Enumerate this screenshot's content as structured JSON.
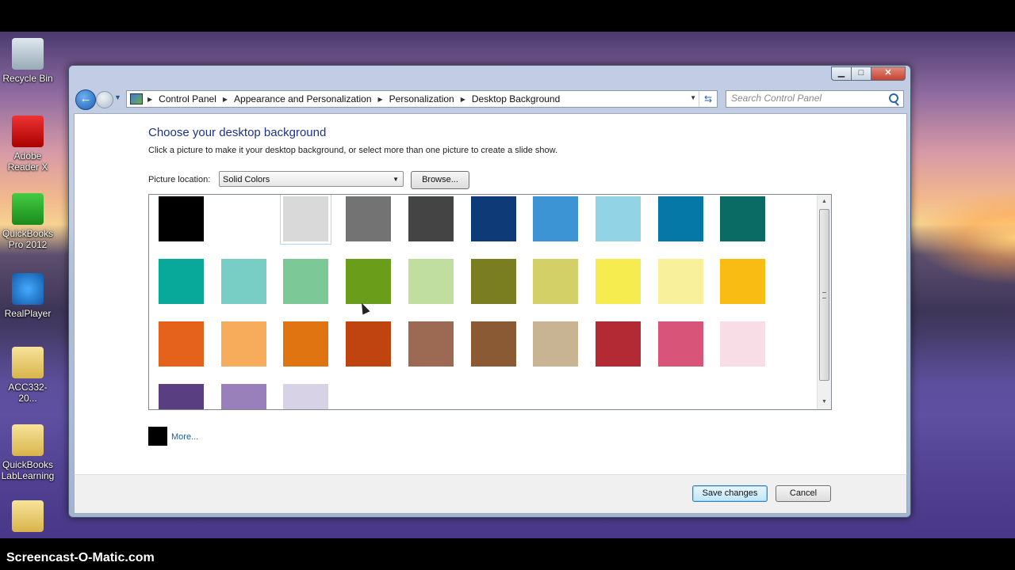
{
  "watermark": "Screencast-O-Matic.com",
  "desktop": {
    "icons": [
      {
        "label": "Recycle Bin",
        "icon": "recycle-bin-icon"
      },
      {
        "label": "Adobe Reader X",
        "icon": "pdf-icon"
      },
      {
        "label": "QuickBooks Pro 2012",
        "icon": "quickbooks-icon"
      },
      {
        "label": "RealPlayer",
        "icon": "realplayer-icon"
      },
      {
        "label": "ACC332-20...",
        "icon": "folder-icon"
      },
      {
        "label": "QuickBooks LabLearning",
        "icon": "folder-icon"
      }
    ]
  },
  "window": {
    "caption": {
      "minimize": "▁",
      "maximize": "□",
      "close": "✕"
    },
    "breadcrumb": [
      "Control Panel",
      "Appearance and Personalization",
      "Personalization",
      "Desktop Background"
    ],
    "search_placeholder": "Search Control Panel",
    "title": "Choose your desktop background",
    "subtitle": "Click a picture to make it your desktop background, or select more than one picture to create a slide show.",
    "picture_location_label": "Picture location:",
    "picture_location_value": "Solid Colors",
    "browse_label": "Browse...",
    "swatches": [
      "#000000",
      "#ffffff",
      "#d9d9d9",
      "#737373",
      "#444444",
      "#0e3a78",
      "#3d94d4",
      "#93d3e6",
      "#0678a8",
      "#0a6a64",
      "#08a89a",
      "#78cdc5",
      "#7cc896",
      "#6a9e1a",
      "#c0dea0",
      "#7a7e20",
      "#d4d068",
      "#f6ec50",
      "#f8f09a",
      "#f8bc12",
      "#e4621c",
      "#f6ac5a",
      "#e07410",
      "#c04410",
      "#9c6a52",
      "#8a5a34",
      "#c8b492",
      "#b42a34",
      "#d85478",
      "#f8dce6",
      "#5a3e82",
      "#9a80ba",
      "#d8d2e6"
    ],
    "selected_swatch": 2,
    "more_label": "More...",
    "more_color": "#000000",
    "save_label": "Save changes",
    "cancel_label": "Cancel"
  }
}
